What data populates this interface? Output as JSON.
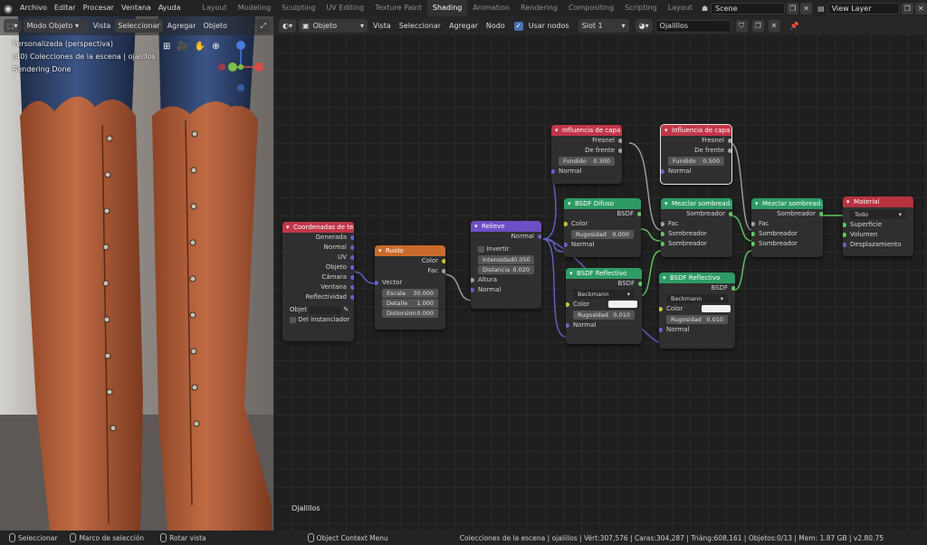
{
  "topbar": {
    "menus": [
      "Archivo",
      "Editar",
      "Procesar",
      "Ventana",
      "Ayuda"
    ],
    "workspaces": [
      "Layout",
      "Modeling",
      "Sculpting",
      "UV Editing",
      "Texture Paint",
      "Shading",
      "Animation",
      "Rendering",
      "Compositing",
      "Scripting",
      "Layout"
    ],
    "active_workspace": "Shading",
    "scene": "Scene",
    "view_layer": "View Layer"
  },
  "viewport": {
    "mode": "Modo Objeto",
    "menus": [
      "Vista",
      "Seleccionar",
      "Agregar",
      "Objeto"
    ],
    "active_menu": "Seleccionar",
    "overlay": [
      "Personalizada (perspectiva)",
      "(40) Colecciones de la escena | ojalillos",
      "Rendering Done"
    ]
  },
  "editor": {
    "type": "Objeto",
    "menus": [
      "Vista",
      "Seleccionar",
      "Agregar",
      "Nodo"
    ],
    "use_nodes_label": "Usar nodos",
    "slot": "Slot 1",
    "material": "Ojalillos",
    "material_label": "Ojalillos",
    "nodes": {
      "coords": {
        "title": "Coordenadas de tex...",
        "outputs": [
          "Generada",
          "Normal",
          "UV",
          "Objeto",
          "Cámara",
          "Ventana",
          "Reflectividad"
        ],
        "objeto_label": "Objet",
        "instancer": "Del instanciador"
      },
      "ruido": {
        "title": "Ruido",
        "outputs": [
          "Color",
          "Fac"
        ],
        "vector": "Vector",
        "fields": [
          {
            "label": "Escala",
            "value": "30.000"
          },
          {
            "label": "Detalle",
            "value": "1.000"
          },
          {
            "label": "Distorsión",
            "value": "0.000"
          }
        ]
      },
      "relieve": {
        "title": "Relieve",
        "output": "Normal",
        "invert": "Invertir",
        "fields": [
          {
            "label": "Intensidad",
            "value": "0.050"
          },
          {
            "label": "Distancia",
            "value": "0.020"
          }
        ],
        "inputs": [
          "Altura",
          "Normal"
        ]
      },
      "capa1": {
        "title": "Influencia de capa",
        "outputs": [
          "Fresnel",
          "De frente"
        ],
        "field": {
          "label": "Fundido",
          "value": "0.300"
        },
        "input": "Normal"
      },
      "capa2": {
        "title": "Influencia de capa",
        "outputs": [
          "Fresnel",
          "De frente"
        ],
        "field": {
          "label": "Fundido",
          "value": "0.500"
        },
        "input": "Normal"
      },
      "difuso": {
        "title": "BSDF Difuso",
        "output": "BSDF",
        "color": "Color",
        "field": {
          "label": "Rugosidad",
          "value": "0.000"
        },
        "input": "Normal"
      },
      "reflectivo1": {
        "title": "BSDF Reflectivo",
        "output": "BSDF",
        "dist": "Beckmann",
        "color": "Color",
        "field": {
          "label": "Rugosidad",
          "value": "0.010"
        },
        "input": "Normal"
      },
      "reflectivo2": {
        "title": "BSDF Reflectivo",
        "output": "BSDF",
        "dist": "Beckmann",
        "color": "Color",
        "field": {
          "label": "Rugosidad",
          "value": "0.010"
        },
        "input": "Normal"
      },
      "mezclar1": {
        "title": "Mezclar sombread...",
        "output": "Sombreador",
        "inputs": [
          "Fac",
          "Sombreador",
          "Sombreador"
        ]
      },
      "mezclar2": {
        "title": "Mezclar sombread...",
        "output": "Sombreador",
        "inputs": [
          "Fac",
          "Sombreador",
          "Sombreador"
        ]
      },
      "material": {
        "title": "Material",
        "target": "Todo",
        "inputs": [
          "Superficie",
          "Volumen",
          "Desplazamiento"
        ]
      }
    }
  },
  "statusbar": {
    "hints": [
      "Seleccionar",
      "Marco de selección",
      "Rotar vista",
      "Object Context Menu"
    ],
    "info": "Colecciones de la escena | ojalillos | Vért:307,576 | Caras:304,287 | Triáng:608,161 | Objetos:0/13 | Mem: 1.87 GB | v2.80.75"
  },
  "colors": {
    "header_input": "#c2364a",
    "header_shader": "#2e9b65",
    "header_texture": "#c96a2b",
    "header_vector": "#6b4fc4",
    "header_output": "#b8323f",
    "accent": "#4772b3"
  }
}
